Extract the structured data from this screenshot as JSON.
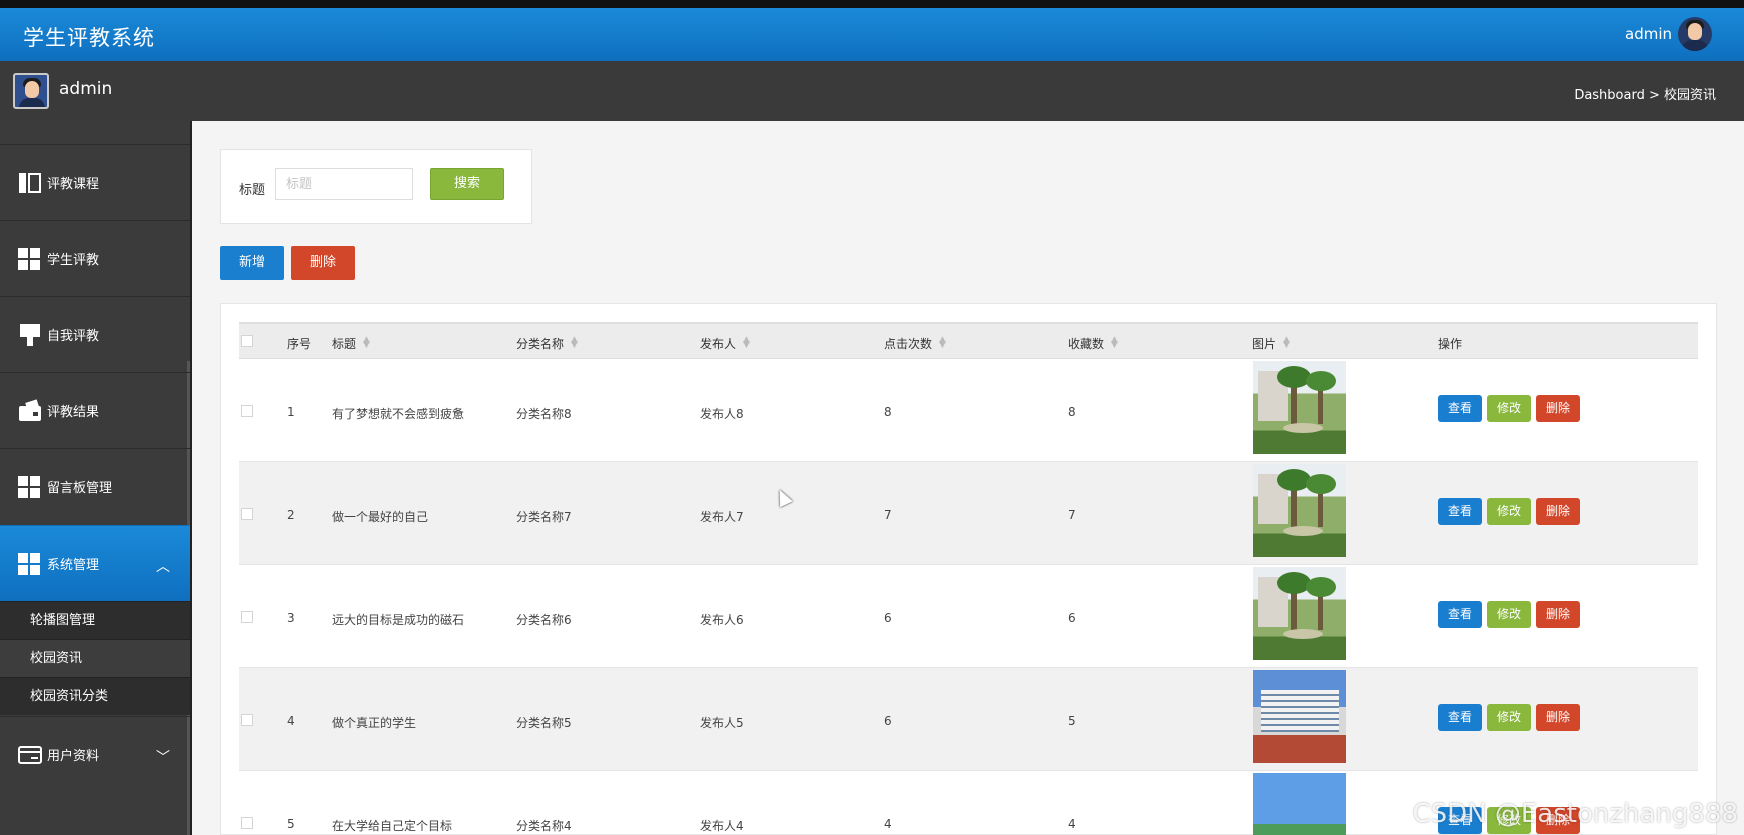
{
  "app": {
    "title": "学生评教系统"
  },
  "top_user": {
    "name": "admin"
  },
  "user": {
    "name": "admin"
  },
  "breadcrumb": {
    "text": "Dashboard > 校园资讯"
  },
  "sidebar": {
    "items": [
      {
        "label": "评教课程",
        "icon": "book-icon"
      },
      {
        "label": "学生评教",
        "icon": "grid-icon"
      },
      {
        "label": "自我评教",
        "icon": "brush-icon"
      },
      {
        "label": "评教结果",
        "icon": "wallet-icon"
      },
      {
        "label": "留言板管理",
        "icon": "grid-icon"
      },
      {
        "label": "系统管理",
        "icon": "grid-icon",
        "active": true,
        "expanded": true
      },
      {
        "label": "用户资料",
        "icon": "card-icon"
      }
    ],
    "sub_items": [
      {
        "label": "轮播图管理"
      },
      {
        "label": "校园资讯",
        "active": true
      },
      {
        "label": "校园资讯分类"
      }
    ]
  },
  "search": {
    "label": "标题",
    "placeholder": "标题",
    "button": "搜索"
  },
  "actions": {
    "add": "新增",
    "delete": "删除"
  },
  "table": {
    "columns": [
      "序号",
      "标题",
      "分类名称",
      "发布人",
      "点击次数",
      "收藏数",
      "图片",
      "操作"
    ],
    "rows": [
      {
        "no": "1",
        "title": "有了梦想就不会感到疲惫",
        "category": "分类名称8",
        "publisher": "发布人8",
        "clicks": "8",
        "favorites": "8",
        "image": "campus-garden"
      },
      {
        "no": "2",
        "title": "做一个最好的自己",
        "category": "分类名称7",
        "publisher": "发布人7",
        "clicks": "7",
        "favorites": "7",
        "image": "campus-garden"
      },
      {
        "no": "3",
        "title": "远大的目标是成功的磁石",
        "category": "分类名称6",
        "publisher": "发布人6",
        "clicks": "6",
        "favorites": "6",
        "image": "campus-garden"
      },
      {
        "no": "4",
        "title": "做个真正的学生",
        "category": "分类名称5",
        "publisher": "发布人5",
        "clicks": "6",
        "favorites": "5",
        "image": "school-building"
      },
      {
        "no": "5",
        "title": "在大学给自己定个目标",
        "category": "分类名称4",
        "publisher": "发布人4",
        "clicks": "4",
        "favorites": "4",
        "image": "road-sky"
      }
    ],
    "row_actions": {
      "view": "查看",
      "edit": "修改",
      "delete": "删除"
    }
  },
  "watermark": "CSDN @Eastonzhang888",
  "colors": {
    "primary": "#1a7ed0",
    "success": "#89b83d",
    "danger": "#d2462a",
    "sidebar": "#3b3b3b"
  }
}
